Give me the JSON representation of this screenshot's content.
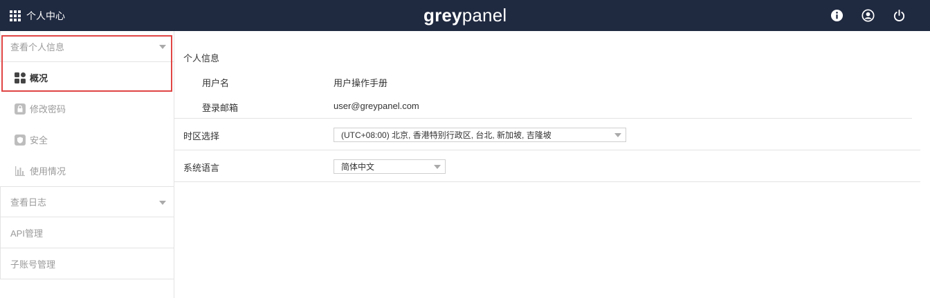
{
  "topbar": {
    "home_label": "个人中心",
    "logo_part1": "grey",
    "logo_part2": "panel",
    "icons": [
      "info-icon",
      "user-icon",
      "power-icon"
    ]
  },
  "sidebar": {
    "section_personal": "查看个人信息",
    "items": [
      {
        "label": "概况",
        "icon": "dashboard-icon",
        "active": true
      },
      {
        "label": "修改密码",
        "icon": "lock-icon"
      },
      {
        "label": "安全",
        "icon": "shield-icon"
      },
      {
        "label": "使用情况",
        "icon": "bar-chart-icon"
      }
    ],
    "section_logs": "查看日志",
    "section_api": "API管理",
    "section_subaccount": "子账号管理"
  },
  "main": {
    "section_title": "个人信息",
    "username_label": "用户名",
    "username_value": "用户操作手册",
    "email_label": "登录邮箱",
    "email_value": "user@greypanel.com",
    "timezone_label": "时区选择",
    "timezone_value": "(UTC+08:00) 北京, 香港特别行政区, 台北, 新加坡, 吉隆坡",
    "language_label": "系统语言",
    "language_value": "简体中文"
  },
  "colors": {
    "topbar_bg": "#1f2940",
    "highlight_border": "#e04444"
  }
}
